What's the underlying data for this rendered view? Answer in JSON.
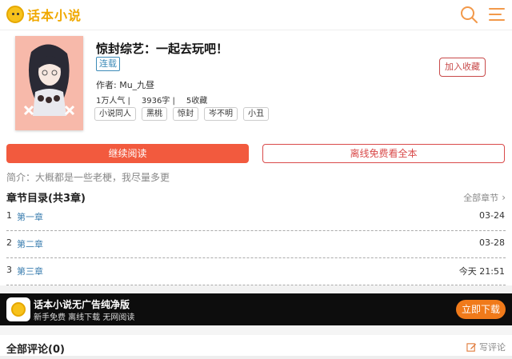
{
  "header": {
    "logo_text": "话本小说",
    "search_icon": "search-icon",
    "menu_icon": "menu-icon",
    "accent": "#f2994a"
  },
  "book": {
    "title": "惊封综艺：一起去玩吧！",
    "status": "连载",
    "author": "作者: Mu_九昼",
    "popularity": "1万人气 |",
    "word_count": "3936字 |",
    "favorites": "5收藏",
    "tags": [
      "小说同人",
      "黑桃",
      "惊封",
      "岑不明",
      "小丑"
    ],
    "add_favorite": "加入收藏",
    "intro": "简介：大概都是一些老梗，我尽量多更"
  },
  "actions": {
    "continue_read": "继续阅读",
    "offline_free": "离线免费看全本"
  },
  "toc": {
    "title": "章节目录(共3章)",
    "all_chapters": "全部章节",
    "chapters": [
      {
        "num": "1",
        "name": "第一章",
        "date": "03-24"
      },
      {
        "num": "2",
        "name": "第二章",
        "date": "03-28"
      },
      {
        "num": "3",
        "name": "第三章",
        "date": "今天 21:51"
      }
    ]
  },
  "banner": {
    "title": "话本小说无广告纯净版",
    "subtitle": "新手免费 离线下载 无网阅读",
    "download": "立即下载"
  },
  "comments": {
    "title": "全部评论(0)",
    "write": "写评论"
  },
  "colors": {
    "primary_red": "#f25a3e",
    "link_blue": "#3d7fb0",
    "download_orange": "#f07a1a"
  }
}
